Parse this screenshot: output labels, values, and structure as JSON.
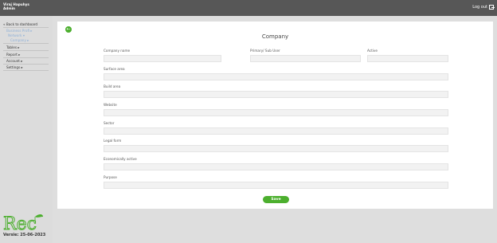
{
  "header": {
    "user_name": "Viraj Hapuhys",
    "user_role": "Admin",
    "logout_label": "Log out"
  },
  "sidebar": {
    "back_label": "« Back to dashboard",
    "sub1": "Business Profi ▸",
    "sub2": "Network ▾",
    "sub3": "Company ▸",
    "items": [
      "Tables ▸",
      "Report ▸",
      "Account ▸",
      "Settings ▸"
    ]
  },
  "logo_text": "Rec",
  "version": "Versie: 25-06-2023",
  "form": {
    "title": "Company",
    "fields": {
      "company_name": {
        "label": "Company name",
        "value": ""
      },
      "primary_sub_user": {
        "label": "Primary/ Sub User",
        "value": ""
      },
      "active": {
        "label": "Active",
        "value": ""
      },
      "surface_area": {
        "label": "Surface area",
        "value": ""
      },
      "build_area": {
        "label": "Build area",
        "value": ""
      },
      "website": {
        "label": "Website",
        "value": ""
      },
      "sector": {
        "label": "Sector",
        "value": ""
      },
      "legal_form": {
        "label": "Legal form",
        "value": ""
      },
      "economically_active": {
        "label": "Economically active",
        "value": ""
      },
      "purpose": {
        "label": "Purpose",
        "value": ""
      }
    },
    "save_label": "Save"
  },
  "colors": {
    "accent": "#4caf2e",
    "topbar": "#575757",
    "background": "#dedede"
  }
}
